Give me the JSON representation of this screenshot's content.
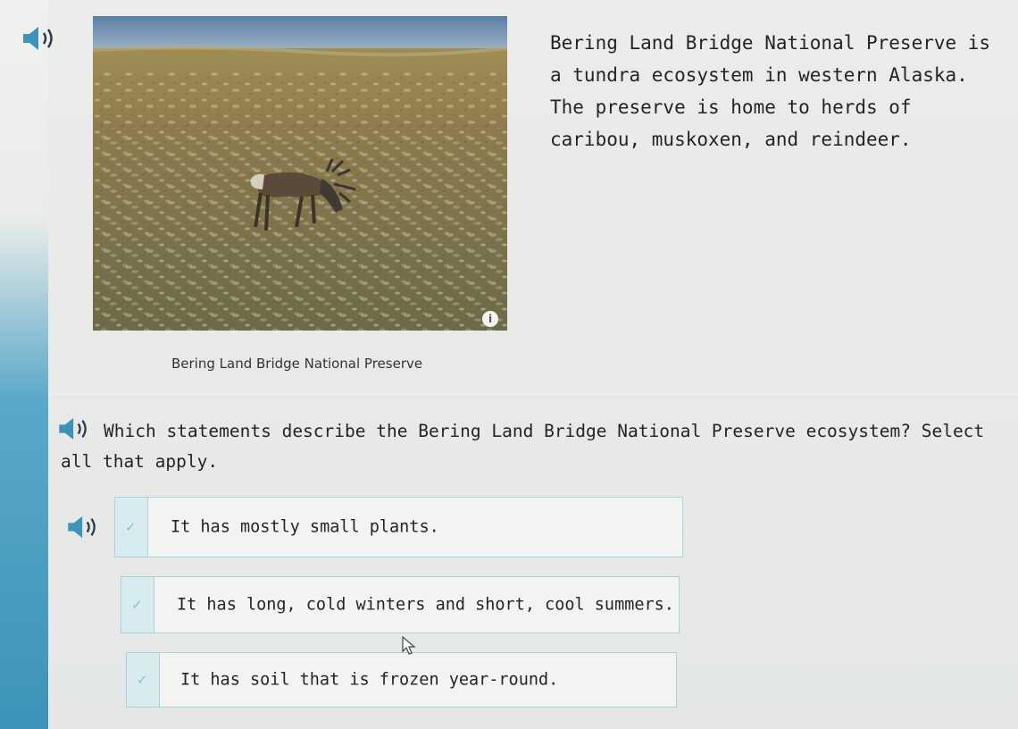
{
  "passage": {
    "text": "Bering Land Bridge National Preserve is a tundra ecosystem in western Alaska. The preserve is home to herds of caribou, muskoxen, and reindeer."
  },
  "photo": {
    "caption": "Bering Land Bridge National Preserve",
    "info_icon_glyph": "i",
    "info_icon": "info-icon"
  },
  "question": {
    "text": "Which statements describe the Bering Land Bridge National Preserve ecosystem? Select all that apply."
  },
  "options": [
    {
      "label": "It has mostly small plants.",
      "check": "✓"
    },
    {
      "label": "It has long, cold winters and short, cool summers.",
      "check": "✓"
    },
    {
      "label": "It has soil that is frozen year-round.",
      "check": "✓"
    }
  ],
  "icons": {
    "audio": "speaker-icon",
    "check": "checkmark-icon",
    "cursor": "mouse-pointer-icon"
  },
  "colors": {
    "accent": "#3d93b8",
    "option_border": "#a9d2dd",
    "check": "#7fc2d4"
  }
}
